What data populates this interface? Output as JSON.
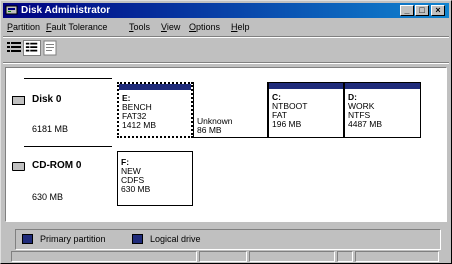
{
  "window": {
    "title": "Disk Administrator"
  },
  "menu": [
    "Partition",
    "Fault Tolerance",
    "Tools",
    "View",
    "Options",
    "Help"
  ],
  "disks": [
    {
      "name": "Disk 0",
      "size": "6181 MB",
      "partitions": [
        {
          "letter": "E:",
          "label": "BENCH",
          "fs": "FAT32",
          "size": "1412 MB"
        },
        {
          "letter": "",
          "label": "",
          "fs": "Unknown",
          "size": "86 MB"
        },
        {
          "letter": "C:",
          "label": "NTBOOT",
          "fs": "FAT",
          "size": "196 MB"
        },
        {
          "letter": "D:",
          "label": "WORK",
          "fs": "NTFS",
          "size": "4487 MB"
        }
      ]
    },
    {
      "name": "CD-ROM 0",
      "size": "630 MB",
      "partitions": [
        {
          "letter": "F:",
          "label": "NEW",
          "fs": "CDFS",
          "size": "630 MB"
        }
      ]
    }
  ],
  "legend": {
    "primary": "Primary partition",
    "logical": "Logical drive"
  },
  "colors": {
    "partition_bar": "#1f2b7a",
    "titlebar": "#000080"
  }
}
